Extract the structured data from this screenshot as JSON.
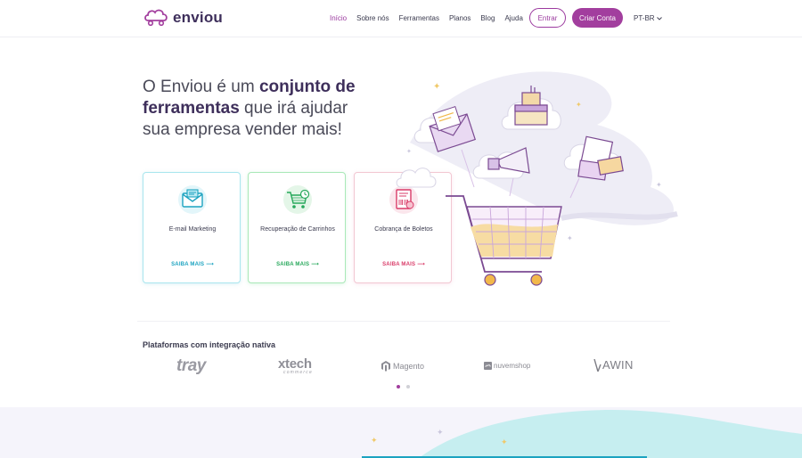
{
  "header": {
    "brand": "enviou",
    "nav": [
      "Início",
      "Sobre nós",
      "Ferramentas",
      "Planos",
      "Blog",
      "Ajuda"
    ],
    "login_label": "Entrar",
    "signup_label": "Criar Conta",
    "language": "PT-BR"
  },
  "hero": {
    "headline_part1": "O Enviou é um ",
    "headline_bold": "conjunto de ferramentas",
    "headline_part2": " que irá ajudar sua empresa vender mais!"
  },
  "cards": [
    {
      "title": "E-mail Marketing",
      "link": "SAIBA MAIS",
      "icon": "envelope-icon",
      "color": "#1ca3c0"
    },
    {
      "title": "Recuperação de Carrinhos",
      "link": "SAIBA MAIS",
      "icon": "cart-icon",
      "color": "#27a85b"
    },
    {
      "title": "Cobrança de Boletos",
      "link": "SAIBA MAIS",
      "icon": "boleto-icon",
      "color": "#d93b68"
    }
  ],
  "integrations": {
    "title": "Plataformas com integração nativa",
    "partners": [
      "tray",
      "xtech",
      "commerce",
      "Magento",
      "nuvemshop",
      "AWIN"
    ]
  },
  "colors": {
    "brand": "#a23e9e",
    "brand_dark": "#3e2f5b"
  }
}
